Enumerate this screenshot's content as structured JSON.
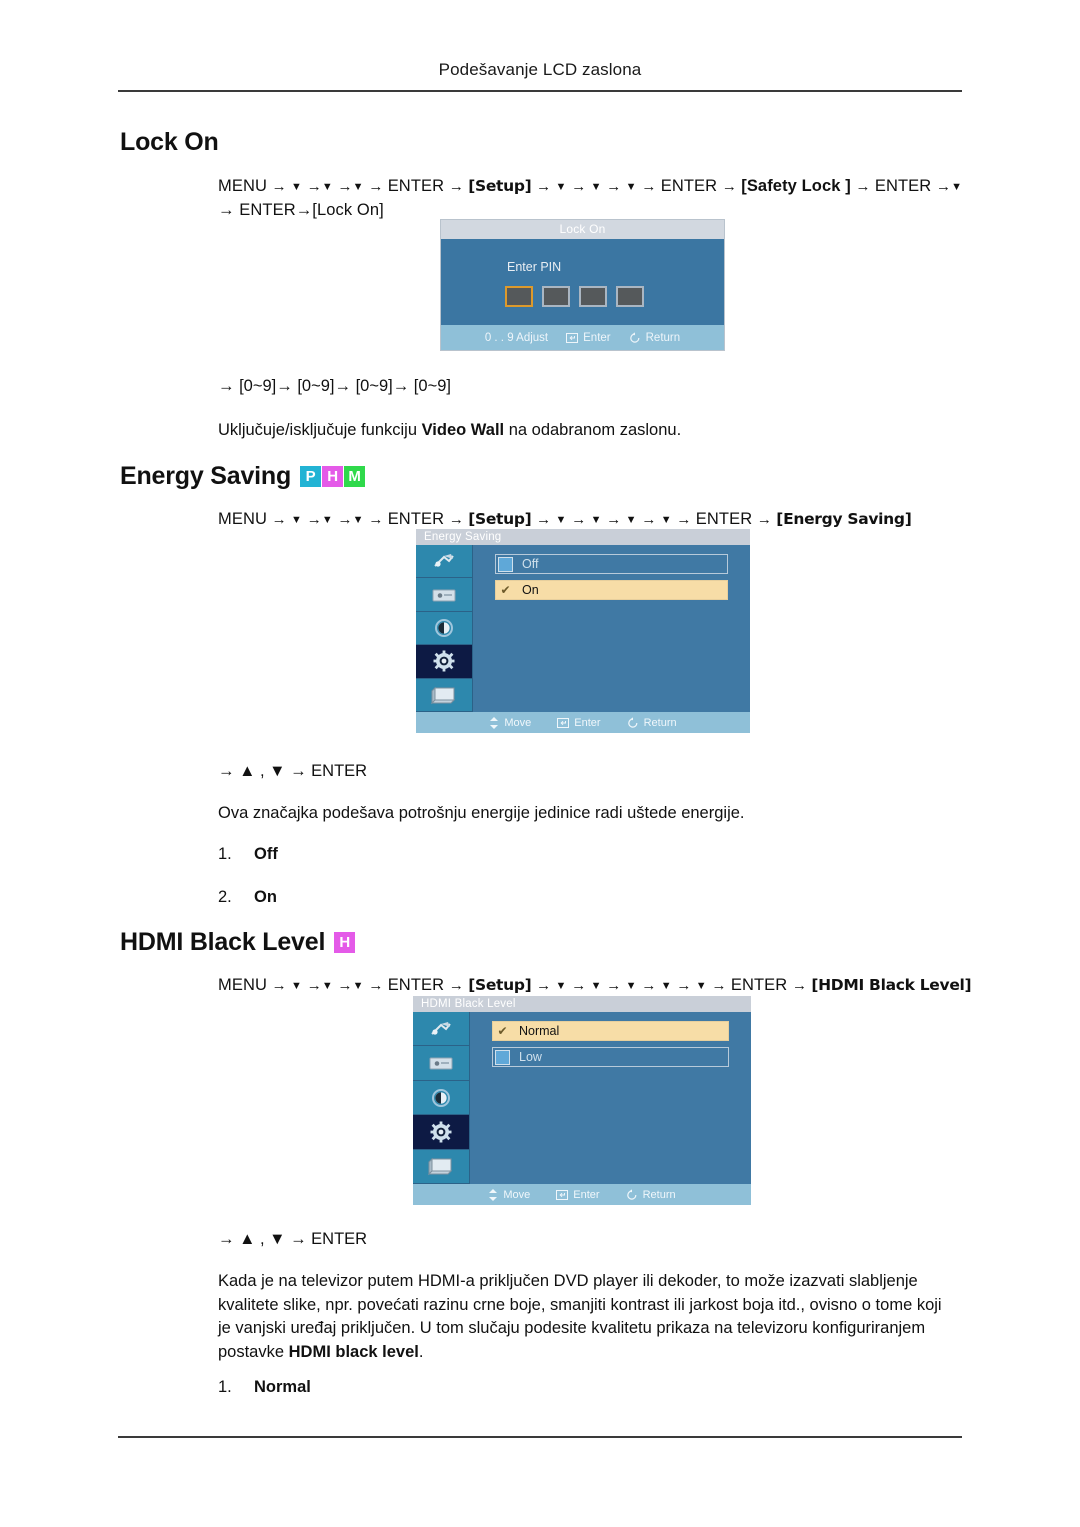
{
  "header": {
    "title": "Podešavanje LCD zaslona"
  },
  "sections": {
    "lock_on": {
      "heading": "Lock On",
      "path_line1": {
        "menu": "MENU",
        "enter1": "ENTER",
        "setup": "[Setup]",
        "enter2": "ENTER",
        "safety_lock": "[Safety Lock ]",
        "enter3": "ENTER"
      },
      "path_line2": "→ ENTER→[Lock On]",
      "pin_sequence": "→ [0~9]→ [0~9]→ [0~9]→ [0~9]",
      "description_pre": "Uključuje/isključuje funkciju ",
      "description_bold": "Video Wall",
      "description_post": " na odabranom zaslonu.",
      "osd": {
        "title": "Lock On",
        "enter_pin_label": "Enter PIN",
        "pin_boxes": 4,
        "focused_box_index": 0,
        "footer": [
          {
            "icon": "digits-icon",
            "label": "0 . . 9  Adjust"
          },
          {
            "icon": "enter-key-icon",
            "label": "Enter"
          },
          {
            "icon": "return-arrow-icon",
            "label": "Return"
          }
        ]
      }
    },
    "energy_saving": {
      "heading": "Energy Saving",
      "badges": [
        {
          "letter": "P",
          "color": "#22b3d4"
        },
        {
          "letter": "H",
          "color": "#e45ae8"
        },
        {
          "letter": "M",
          "color": "#2fd94b"
        }
      ],
      "path": {
        "menu": "MENU",
        "enter1": "ENTER",
        "setup": "[Setup]",
        "enter2": "ENTER",
        "target": "[Energy Saving]"
      },
      "nav_hint": "→ ▲ , ▼ → ENTER",
      "description": "Ova značajka podešava potrošnju energije jedinice radi uštede energije.",
      "list": [
        {
          "num": "1.",
          "text": "Off"
        },
        {
          "num": "2.",
          "text": "On"
        }
      ],
      "osd": {
        "title": "Energy Saving",
        "options": [
          {
            "label": "Off",
            "selected": false
          },
          {
            "label": "On",
            "selected": true
          }
        ],
        "sidebar_icons": [
          "picture-icon",
          "screen-icon",
          "contrast-icon",
          "setup-gear-icon",
          "display-icon"
        ],
        "active_sidebar_index": 3,
        "footer": [
          {
            "icon": "move-diamond-icon",
            "label": "Move"
          },
          {
            "icon": "enter-key-icon",
            "label": "Enter"
          },
          {
            "icon": "return-arrow-icon",
            "label": "Return"
          }
        ]
      }
    },
    "hdmi_black_level": {
      "heading": "HDMI Black Level",
      "badges": [
        {
          "letter": "H",
          "color": "#e45ae8"
        }
      ],
      "path": {
        "menu": "MENU",
        "enter1": "ENTER",
        "setup": "[Setup]",
        "enter2": "ENTER",
        "target": "[HDMI Black Level]"
      },
      "nav_hint": "→ ▲ , ▼ → ENTER",
      "description_pre": "Kada je na televizor putem HDMI-a priključen DVD player ili dekoder, to može izazvati slabljenje kvalitete slike, npr. povećati razinu crne boje, smanjiti kontrast ili jarkost boja itd., ovisno o tome koji je vanjski uređaj priključen. U tom slučaju podesite kvalitetu prikaza na televizoru konfiguriranjem postavke ",
      "description_bold": "HDMI black level",
      "description_post": ".",
      "list": [
        {
          "num": "1.",
          "text": "Normal"
        }
      ],
      "osd": {
        "title": "HDMI Black Level",
        "options": [
          {
            "label": "Normal",
            "selected": true
          },
          {
            "label": "Low",
            "selected": false
          }
        ],
        "sidebar_icons": [
          "picture-icon",
          "screen-icon",
          "contrast-icon",
          "setup-gear-icon",
          "display-icon"
        ],
        "active_sidebar_index": 3,
        "footer": [
          {
            "icon": "move-diamond-icon",
            "label": "Move"
          },
          {
            "icon": "enter-key-icon",
            "label": "Enter"
          },
          {
            "icon": "return-arrow-icon",
            "label": "Return"
          }
        ]
      }
    }
  },
  "glyphs": {
    "arrow": "→",
    "down": "▼",
    "up": "▲",
    "check": "✔"
  }
}
